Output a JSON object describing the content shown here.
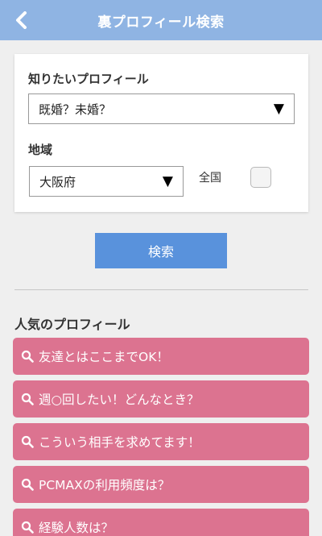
{
  "header": {
    "title": "裏プロフィール検索",
    "back_icon": "chevron-left-icon",
    "background_color": "#8fb4e3"
  },
  "form": {
    "profile_label": "知りたいプロフィール",
    "profile_select_value": "既婚？未婚？",
    "region_label": "地域",
    "region_select_value": "大阪府",
    "nationwide_label": "全国",
    "nationwide_checked": false,
    "dropdown_arrow": "▼"
  },
  "search_button": {
    "label": "検索",
    "color": "#5992dc"
  },
  "popular": {
    "title": "人気のプロフィール",
    "item_color": "#dc7390",
    "items": [
      "友達とはここまでOK！",
      "週○回したい！どんなとき？",
      "こういう相手を求めてます！",
      "PCMAXの利用頻度は？",
      "経験人数は？"
    ]
  }
}
